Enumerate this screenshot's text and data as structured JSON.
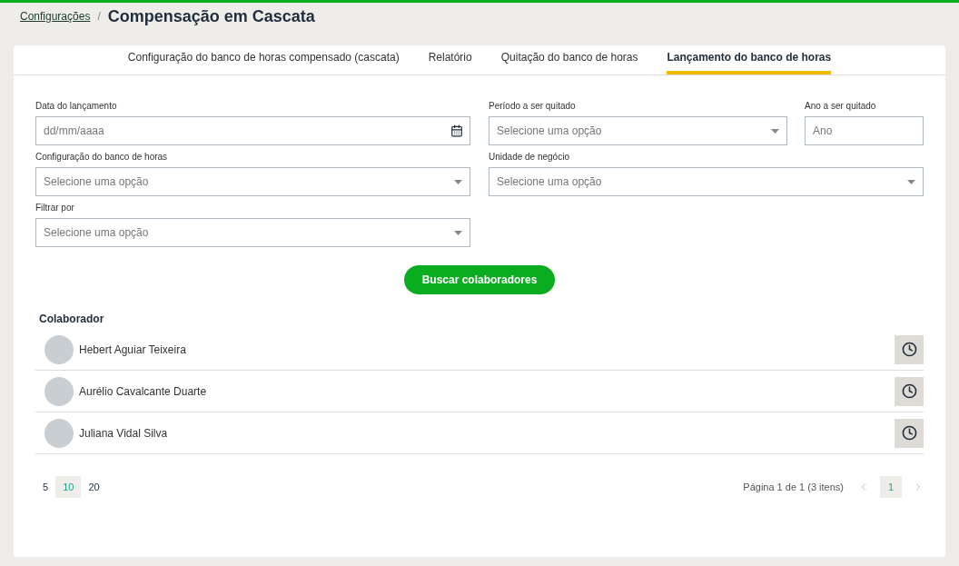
{
  "breadcrumb": {
    "link": "Configurações",
    "separator": "/",
    "title": "Compensação em Cascata"
  },
  "tabs": [
    {
      "label": "Configuração do banco de horas compensado (cascata)",
      "selected": false
    },
    {
      "label": "Relatório",
      "selected": false
    },
    {
      "label": "Quitação do banco de horas",
      "selected": false
    },
    {
      "label": "Lançamento do banco de horas",
      "selected": true
    }
  ],
  "form": {
    "rows": [
      [
        {
          "kind": "date",
          "label": "Data do lançamento",
          "placeholder": "dd/mm/aaaa"
        },
        {
          "kind": "select",
          "label": "Período a ser quitado",
          "placeholder": "Selecione uma opção"
        },
        {
          "kind": "text",
          "label": "Ano a ser quitado",
          "placeholder": "Ano"
        }
      ],
      [
        {
          "kind": "select",
          "label": "Configuração do banco de horas",
          "placeholder": "Selecione uma opção"
        },
        {
          "kind": "select",
          "label": "Unidade de negócio",
          "placeholder": "Selecione uma opção"
        }
      ],
      [
        {
          "kind": "select",
          "label": "Filtrar por",
          "placeholder": "Selecione uma opção"
        }
      ]
    ],
    "submit": "Buscar colaboradores"
  },
  "table": {
    "header": "Colaborador",
    "rows": [
      {
        "name": "Hebert Aguiar Teixeira"
      },
      {
        "name": "Aurélio Cavalcante Duarte"
      },
      {
        "name": "Juliana Vidal Silva"
      }
    ]
  },
  "pagination": {
    "page_sizes": [
      {
        "label": "5",
        "selected": false
      },
      {
        "label": "10",
        "selected": true
      },
      {
        "label": "20",
        "selected": false
      }
    ],
    "info": "Página 1 de 1 (3 itens)",
    "pages": [
      {
        "label": "1",
        "selected": true
      }
    ]
  }
}
